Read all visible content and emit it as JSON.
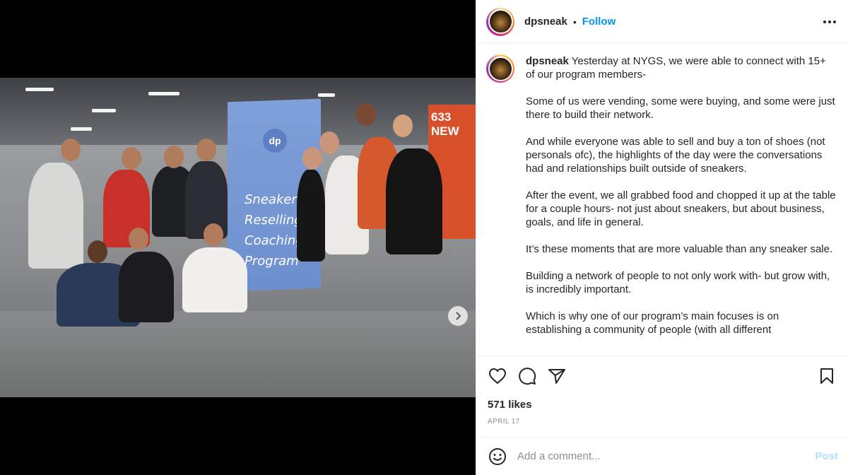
{
  "post": {
    "username": "dpsneak",
    "separator": "•",
    "follow_label": "Follow",
    "more_icon": "more-horizontal-icon"
  },
  "photo": {
    "banner_logo": "dp",
    "banner_text": "Sneaker Reselling Coaching Program",
    "sign_text": "633 NEW",
    "carousel": {
      "current": 1,
      "total": 2
    }
  },
  "caption": {
    "username": "dpsneak",
    "paragraphs": [
      "Yesterday at NYGS, we were able to connect with 15+ of our program members-",
      "Some of us were vending, some were buying, and some were just there to build their network.",
      "And while everyone was able to sell and buy a ton of shoes (not personals ofc), the highlights of the day were the conversations had and relationships built outside of sneakers.",
      "After the event, we all grabbed food and chopped it up at the table for a couple hours- not just about sneakers, but about business, goals, and life in general.",
      "It’s these moments that are more valuable than any sneaker sale.",
      "Building a network of people to not only work with- but grow with, is incredibly important.",
      "Which is why one of our program’s main focuses is on establishing a community of people (with all different"
    ]
  },
  "actions": {
    "icons": [
      "heart-icon",
      "comment-icon",
      "share-icon",
      "bookmark-icon"
    ],
    "likes": "571 likes",
    "date": "APRIL 17"
  },
  "comment": {
    "placeholder": "Add a comment...",
    "post_label": "Post",
    "emoji_icon": "emoji-icon"
  },
  "colors": {
    "accent": "#0095f6",
    "post_disabled": "#b2dffc",
    "muted": "#8e8e8e"
  }
}
